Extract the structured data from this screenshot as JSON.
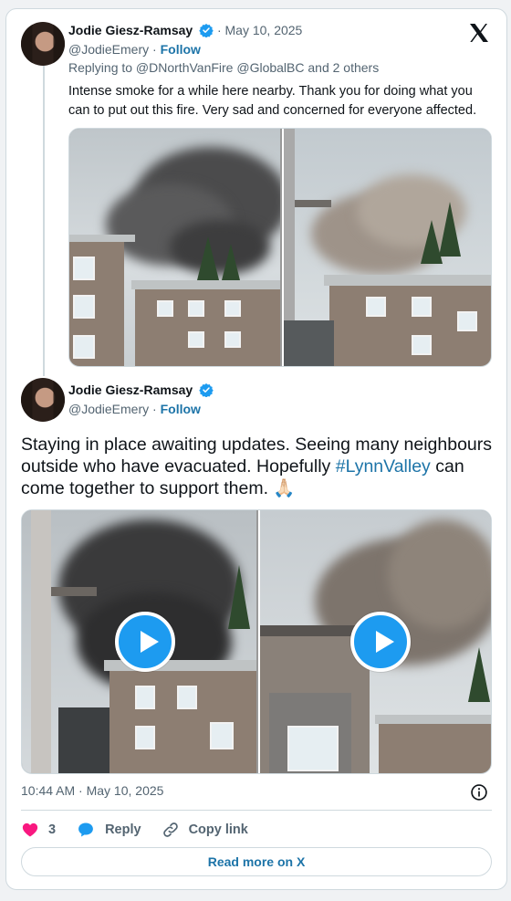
{
  "tweet1": {
    "author_name": "Jodie Giesz-Ramsay",
    "date": "· May 10, 2025",
    "handle": "@JodieEmery",
    "separator": "·",
    "follow_label": "Follow",
    "replying_to": "Replying to @DNorthVanFire @GlobalBC and 2 others",
    "text": "Intense smoke for a while here nearby. Thank you for doing what you can to put out this fire. Very sad and concerned for everyone affected."
  },
  "tweet2": {
    "author_name": "Jodie Giesz-Ramsay",
    "handle": "@JodieEmery",
    "separator": "·",
    "follow_label": "Follow",
    "text_before": "Staying in place awaiting updates. Seeing many neighbours outside who have evacuated. Hopefully ",
    "hashtag": "#LynnValley",
    "text_after": " can come together to support them. 🙏🏻",
    "timestamp": "10:44 AM · May 10, 2025"
  },
  "actions": {
    "like_count": "3",
    "reply_label": "Reply",
    "copy_link_label": "Copy link"
  },
  "read_more_label": "Read more on X",
  "icons": {
    "verified": "verified-badge-icon",
    "x_logo": "x-logo-icon",
    "heart": "heart-icon",
    "reply": "reply-bubble-icon",
    "link": "link-icon",
    "info": "info-icon",
    "play": "play-icon"
  },
  "colors": {
    "accent": "#1d9bf0",
    "link_text": "#1d74a8",
    "heart": "#f91880",
    "muted_text": "#536471",
    "border": "#cfd9de"
  }
}
